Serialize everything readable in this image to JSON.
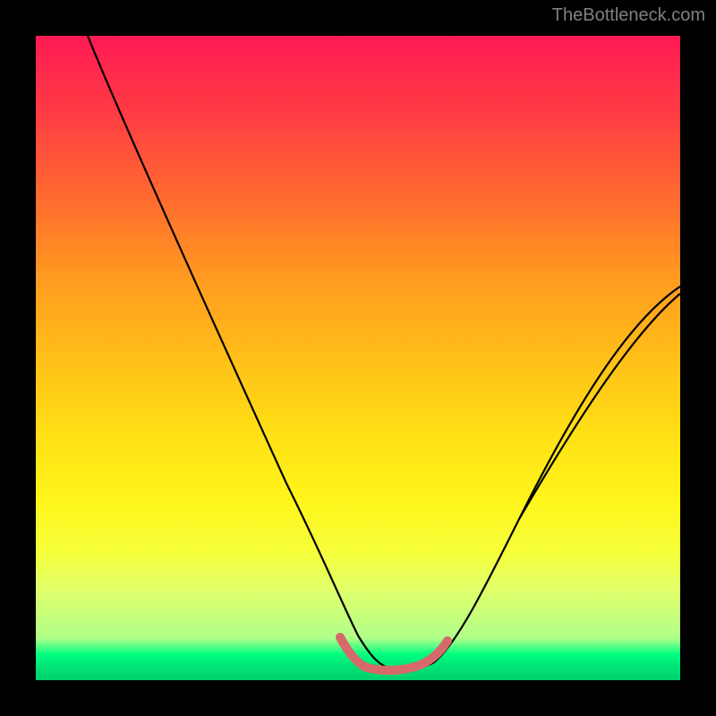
{
  "watermark": "TheBottleneck.com",
  "chart_data": {
    "type": "line",
    "title": "",
    "xlabel": "",
    "ylabel": "",
    "xlim": [
      0,
      100
    ],
    "ylim": [
      0,
      100
    ],
    "grid": false,
    "series": [
      {
        "name": "bottleneck-curve",
        "x": [
          8,
          12,
          20,
          30,
          40,
          46,
          50,
          53,
          56,
          60,
          64,
          68,
          75,
          85,
          100
        ],
        "y": [
          100,
          90,
          72,
          50,
          28,
          15,
          7,
          3,
          2,
          3,
          7,
          14,
          26,
          42,
          60
        ]
      }
    ],
    "highlight_region": {
      "x_start": 47,
      "x_end": 64,
      "description": "optimal-range-marker"
    },
    "gradient_colors": {
      "top": "#ff1953",
      "bottom": "#00d06e"
    }
  }
}
